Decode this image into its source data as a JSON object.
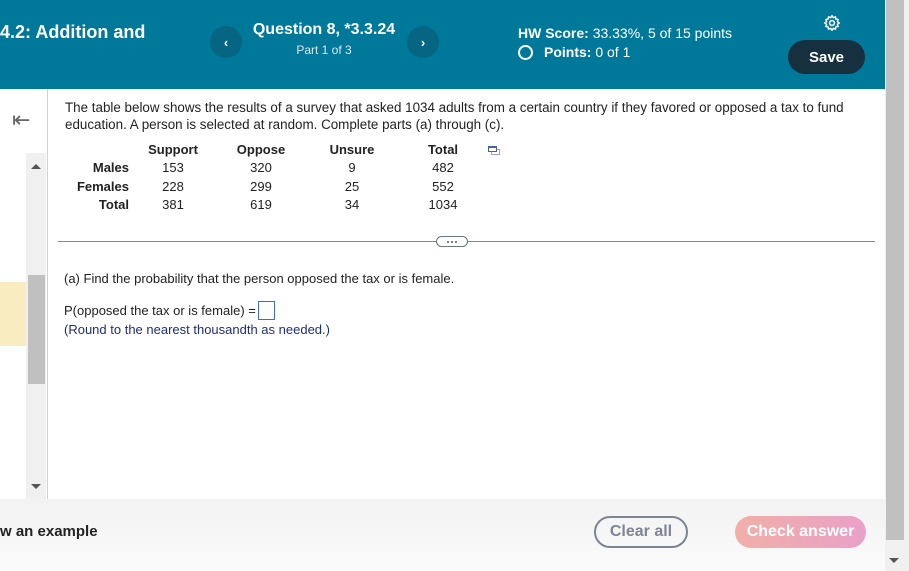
{
  "header": {
    "section_title": "4.2: Addition and",
    "question_title": "Question 8, *3.3.24",
    "question_part": "Part 1 of 3",
    "prev_icon": "chevron-left",
    "next_icon": "chevron-right",
    "hw_score_label": "HW Score:",
    "hw_score_value": "33.33%, 5 of 15 points",
    "points_label": "Points:",
    "points_value": "0 of 1",
    "settings_icon": "gear",
    "save_label": "Save",
    "colors": {
      "header_bg": "#00789a",
      "save_bg": "#16303f"
    }
  },
  "sidebar": {
    "collapse_icon": "collapse-left-arrow",
    "collapse_glyph": "⇤"
  },
  "question": {
    "intro": "The table below shows the results of a survey that asked 1034 adults from a certain country if they favored or opposed a tax to fund education. A person is selected at random. Complete parts (a) through (c).",
    "table": {
      "columns": [
        "",
        "Support",
        "Oppose",
        "Unsure",
        "Total"
      ],
      "rows": [
        {
          "label": "Males",
          "values": [
            "153",
            "320",
            "9",
            "482"
          ]
        },
        {
          "label": "Females",
          "values": [
            "228",
            "299",
            "25",
            "552"
          ]
        },
        {
          "label": "Total",
          "values": [
            "381",
            "619",
            "34",
            "1034"
          ]
        }
      ]
    },
    "part_a_prompt": "(a) Find the probability that the person opposed the tax or is female.",
    "answer_label": "P(opposed the tax or is female) =",
    "answer_value": "",
    "hint": "(Round to the nearest thousandth as needed.)"
  },
  "footer": {
    "example_label": "w an example",
    "clear_label": "Clear all",
    "check_label": "Check answer"
  }
}
